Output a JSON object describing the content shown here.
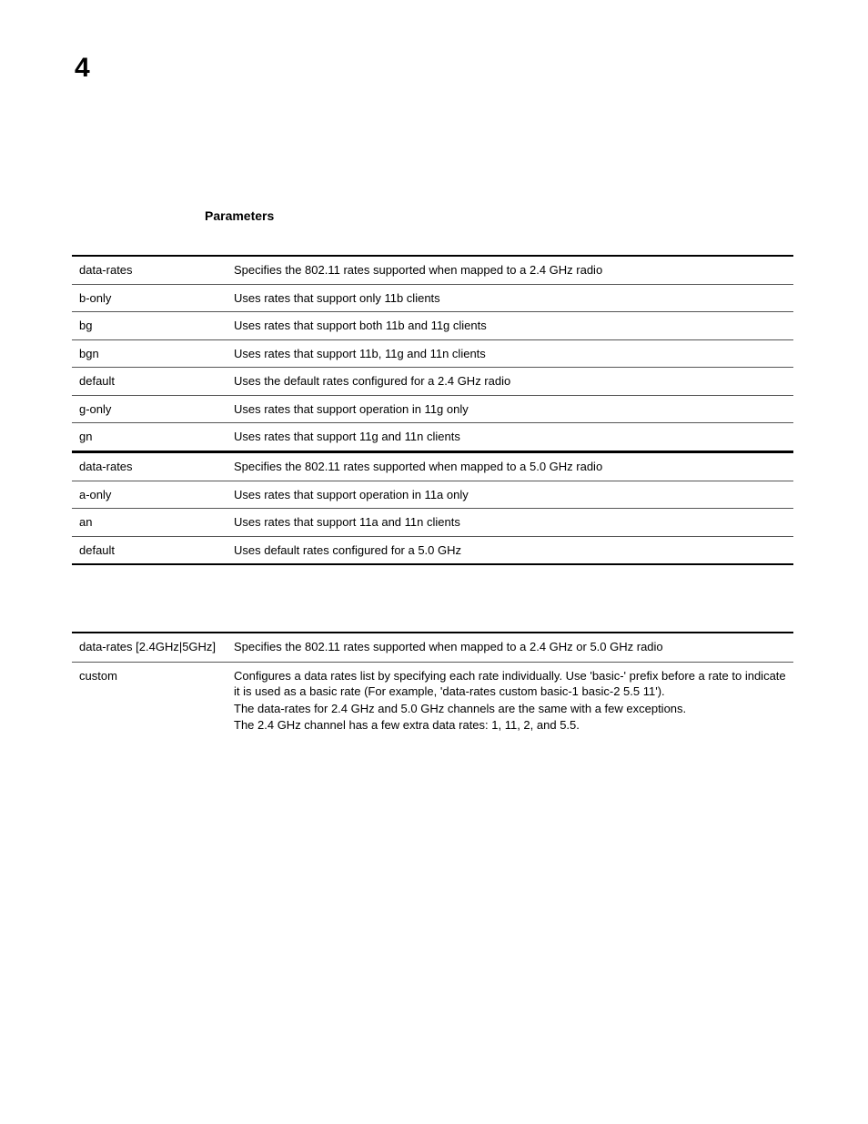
{
  "page_number": "4",
  "section_heading": "Parameters",
  "table1": {
    "rows": [
      {
        "term": "data-rates",
        "desc": "Specifies the 802.11 rates supported when mapped to a 2.4 GHz radio"
      },
      {
        "term": "b-only",
        "desc": "Uses rates that support only 11b clients"
      },
      {
        "term": "bg",
        "desc": "Uses rates that support both 11b and 11g clients"
      },
      {
        "term": "bgn",
        "desc": "Uses rates that support 11b, 11g and 11n clients"
      },
      {
        "term": "default",
        "desc": "Uses the default rates configured for a 2.4 GHz radio"
      },
      {
        "term": "g-only",
        "desc": "Uses rates that support operation in 11g only"
      },
      {
        "term": "gn",
        "desc": "Uses rates that support 11g and 11n clients"
      }
    ]
  },
  "table2": {
    "rows": [
      {
        "term": "data-rates",
        "desc": "Specifies the 802.11 rates supported when mapped to a 5.0 GHz radio"
      },
      {
        "term": "a-only",
        "desc": "Uses rates that support operation in 11a only"
      },
      {
        "term": "an",
        "desc": "Uses rates that support 11a and 11n clients"
      },
      {
        "term": "default",
        "desc": "Uses default rates configured for a 5.0 GHz"
      }
    ]
  },
  "table3": {
    "rows": [
      {
        "term": "data-rates [2.4GHz|5GHz]",
        "desc_lines": [
          "Specifies the 802.11 rates supported when mapped to a 2.4 GHz or 5.0 GHz radio"
        ]
      },
      {
        "term": "custom",
        "desc_lines": [
          "Configures a data rates list by specifying each rate individually. Use 'basic-' prefix before a rate to indicate it is used as a basic rate (For example, 'data-rates custom basic-1 basic-2 5.5 11').",
          "The data-rates for 2.4 GHz and 5.0 GHz channels are the same with a few exceptions.",
          "The 2.4 GHz channel has a few extra data rates: 1, 11, 2, and 5.5."
        ]
      }
    ]
  }
}
